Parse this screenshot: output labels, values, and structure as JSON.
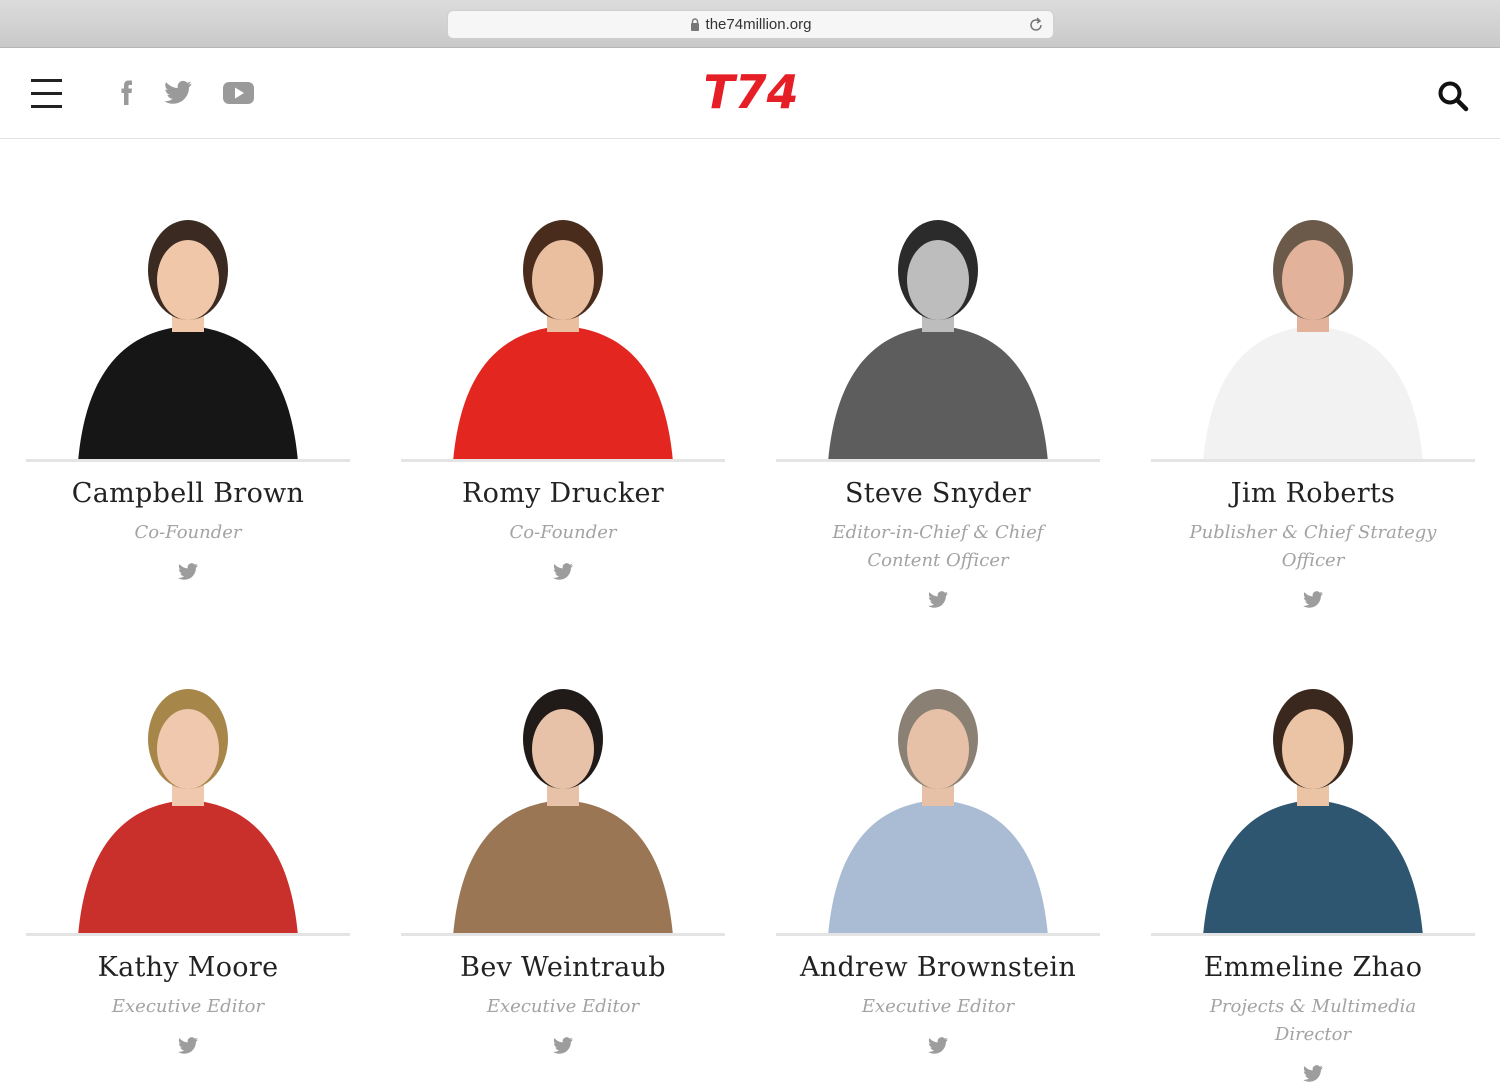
{
  "browser": {
    "url": "the74million.org"
  },
  "header": {
    "logo_text": "T74",
    "social": [
      "facebook-icon",
      "twitter-icon",
      "youtube-icon"
    ],
    "brand_color": "#e61e25"
  },
  "team": [
    {
      "name": "Campbell Brown",
      "role": "Co-Founder",
      "bg": "#ffffff",
      "shirt": "#161616",
      "hair": "#3b2a22",
      "skin": "#f0c7a8"
    },
    {
      "name": "Romy Drucker",
      "role": "Co-Founder",
      "bg": "#ffffff",
      "shirt": "#e3261f",
      "hair": "#4a2c1d",
      "skin": "#e9bfa0"
    },
    {
      "name": "Steve Snyder",
      "role": "Editor-in-Chief & Chief Content Officer",
      "bg": "#ffffff",
      "shirt": "#5d5d5d",
      "hair": "#2b2b2b",
      "skin": "#bdbdbd"
    },
    {
      "name": "Jim Roberts",
      "role": "Publisher & Chief Strategy Officer",
      "bg": "#ffffff",
      "shirt": "#f2f2f2",
      "hair": "#6b5a4a",
      "skin": "#e2b39a"
    },
    {
      "name": "Kathy Moore",
      "role": "Executive Editor",
      "bg": "#ffffff",
      "shirt": "#c9302c",
      "hair": "#a7864a",
      "skin": "#efc8ae"
    },
    {
      "name": "Bev Weintraub",
      "role": "Executive Editor",
      "bg": "#ffffff",
      "shirt": "#9a7654",
      "hair": "#201a18",
      "skin": "#e7c2a8"
    },
    {
      "name": "Andrew Brownstein",
      "role": "Executive Editor",
      "bg": "#ffffff",
      "shirt": "#a9bcd3",
      "hair": "#8a8073",
      "skin": "#e6c0a7"
    },
    {
      "name": "Emmeline Zhao",
      "role": "Projects & Multimedia Director",
      "bg": "#ffffff",
      "shirt": "#2f5670",
      "hair": "#3a271d",
      "skin": "#eac4a4"
    }
  ]
}
